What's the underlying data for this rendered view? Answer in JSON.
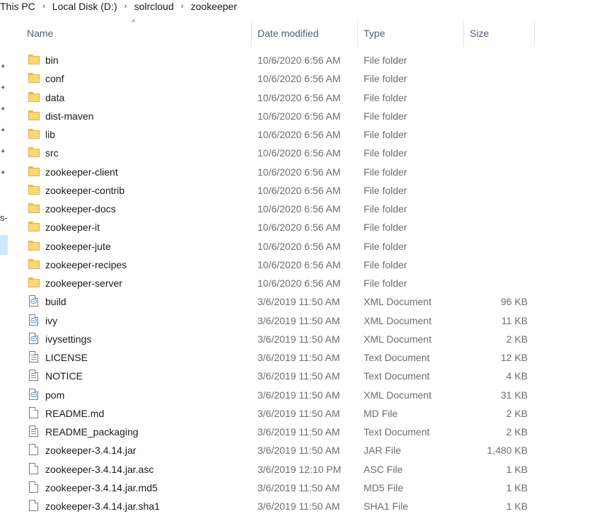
{
  "breadcrumb": [
    {
      "label": "This PC"
    },
    {
      "label": "Local Disk (D:)"
    },
    {
      "label": "solrcloud"
    },
    {
      "label": "zookeeper"
    }
  ],
  "breadcrumb_separator": "›",
  "columns": {
    "name": "Name",
    "date": "Date modified",
    "type": "Type",
    "size": "Size"
  },
  "sort_indicator": "^",
  "left_pane_text": "s-",
  "files": [
    {
      "name": "bin",
      "date": "10/6/2020 6:56 AM",
      "type": "File folder",
      "size": "",
      "icon": "folder-icon"
    },
    {
      "name": "conf",
      "date": "10/6/2020 6:56 AM",
      "type": "File folder",
      "size": "",
      "icon": "folder-icon"
    },
    {
      "name": "data",
      "date": "10/6/2020 6:56 AM",
      "type": "File folder",
      "size": "",
      "icon": "folder-icon"
    },
    {
      "name": "dist-maven",
      "date": "10/6/2020 6:56 AM",
      "type": "File folder",
      "size": "",
      "icon": "folder-icon"
    },
    {
      "name": "lib",
      "date": "10/6/2020 6:56 AM",
      "type": "File folder",
      "size": "",
      "icon": "folder-icon"
    },
    {
      "name": "src",
      "date": "10/6/2020 6:56 AM",
      "type": "File folder",
      "size": "",
      "icon": "folder-icon"
    },
    {
      "name": "zookeeper-client",
      "date": "10/6/2020 6:56 AM",
      "type": "File folder",
      "size": "",
      "icon": "folder-icon"
    },
    {
      "name": "zookeeper-contrib",
      "date": "10/6/2020 6:56 AM",
      "type": "File folder",
      "size": "",
      "icon": "folder-icon"
    },
    {
      "name": "zookeeper-docs",
      "date": "10/6/2020 6:56 AM",
      "type": "File folder",
      "size": "",
      "icon": "folder-icon"
    },
    {
      "name": "zookeeper-it",
      "date": "10/6/2020 6:56 AM",
      "type": "File folder",
      "size": "",
      "icon": "folder-icon"
    },
    {
      "name": "zookeeper-jute",
      "date": "10/6/2020 6:56 AM",
      "type": "File folder",
      "size": "",
      "icon": "folder-icon"
    },
    {
      "name": "zookeeper-recipes",
      "date": "10/6/2020 6:56 AM",
      "type": "File folder",
      "size": "",
      "icon": "folder-icon"
    },
    {
      "name": "zookeeper-server",
      "date": "10/6/2020 6:56 AM",
      "type": "File folder",
      "size": "",
      "icon": "folder-icon"
    },
    {
      "name": "build",
      "date": "3/6/2019 11:50 AM",
      "type": "XML Document",
      "size": "96 KB",
      "icon": "xml-file-icon"
    },
    {
      "name": "ivy",
      "date": "3/6/2019 11:50 AM",
      "type": "XML Document",
      "size": "11 KB",
      "icon": "xml-file-icon"
    },
    {
      "name": "ivysettings",
      "date": "3/6/2019 11:50 AM",
      "type": "XML Document",
      "size": "2 KB",
      "icon": "xml-file-icon"
    },
    {
      "name": "LICENSE",
      "date": "3/6/2019 11:50 AM",
      "type": "Text Document",
      "size": "12 KB",
      "icon": "text-file-icon"
    },
    {
      "name": "NOTICE",
      "date": "3/6/2019 11:50 AM",
      "type": "Text Document",
      "size": "4 KB",
      "icon": "text-file-icon"
    },
    {
      "name": "pom",
      "date": "3/6/2019 11:50 AM",
      "type": "XML Document",
      "size": "31 KB",
      "icon": "xml-file-icon"
    },
    {
      "name": "README.md",
      "date": "3/6/2019 11:50 AM",
      "type": "MD File",
      "size": "2 KB",
      "icon": "blank-file-icon"
    },
    {
      "name": "README_packaging",
      "date": "3/6/2019 11:50 AM",
      "type": "Text Document",
      "size": "2 KB",
      "icon": "text-file-icon"
    },
    {
      "name": "zookeeper-3.4.14.jar",
      "date": "3/6/2019 11:50 AM",
      "type": "JAR File",
      "size": "1,480 KB",
      "icon": "blank-file-icon"
    },
    {
      "name": "zookeeper-3.4.14.jar.asc",
      "date": "3/6/2019 12:10 PM",
      "type": "ASC File",
      "size": "1 KB",
      "icon": "blank-file-icon"
    },
    {
      "name": "zookeeper-3.4.14.jar.md5",
      "date": "3/6/2019 11:50 AM",
      "type": "MD5 File",
      "size": "1 KB",
      "icon": "blank-file-icon"
    },
    {
      "name": "zookeeper-3.4.14.jar.sha1",
      "date": "3/6/2019 11:50 AM",
      "type": "SHA1 File",
      "size": "1 KB",
      "icon": "blank-file-icon"
    }
  ]
}
